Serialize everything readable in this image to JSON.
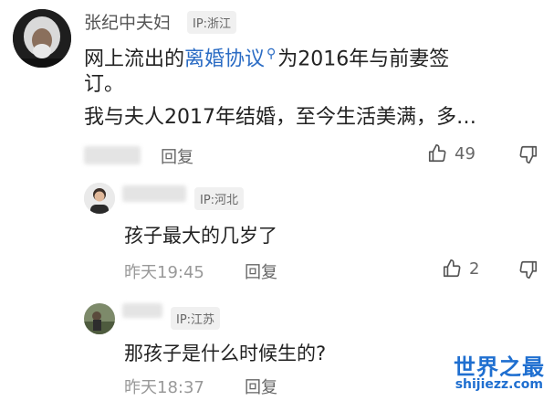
{
  "comment": {
    "author": "张纪中夫妇",
    "ip": "IP:浙江",
    "text_line1_before": "网上流出的",
    "text_line1_link": "离婚协议",
    "text_line1_after": "为2016年与前妻签",
    "text_line2": "订。",
    "text_line3": "我与夫人2017年结婚，至今生活美满，多…",
    "reply_label": "回复",
    "like_count": "49"
  },
  "replies": [
    {
      "ip": "IP:河北",
      "text": "孩子最大的几岁了",
      "time": "昨天19:45",
      "reply_label": "回复",
      "like_count": "2"
    },
    {
      "ip": "IP:江苏",
      "text": "那孩子是什么时候生的?",
      "time": "昨天18:37",
      "reply_label": "回复"
    }
  ],
  "watermark": {
    "logo": "世界之最",
    "url": "shijiezz.com"
  },
  "icons": {
    "like": "thumbs-up-icon",
    "dislike": "thumbs-down-icon",
    "search": "search-icon"
  },
  "colors": {
    "link": "#2b6cc4",
    "watermark": "#1f6fd0"
  }
}
